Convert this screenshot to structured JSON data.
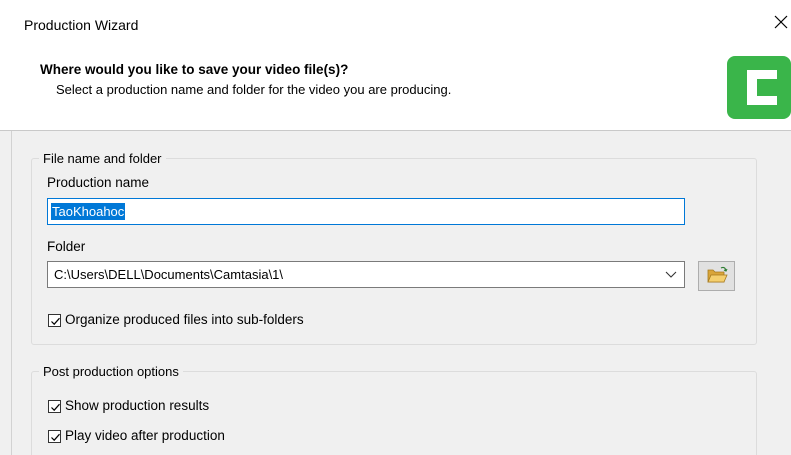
{
  "window": {
    "title": "Production Wizard"
  },
  "header": {
    "title": "Where would you like to save your video file(s)?",
    "subtitle": "Select a production name and folder for the video you are producing.",
    "logo_color": "#3ab54a"
  },
  "file_group": {
    "legend": "File name and folder",
    "production_name_label": "Production name",
    "production_name_value": "TaoKhoahoc",
    "folder_label": "Folder",
    "folder_value": "C:\\Users\\DELL\\Documents\\Camtasia\\1\\",
    "organize_label": "Organize produced files into sub-folders",
    "organize_checked": true
  },
  "post_group": {
    "legend": "Post production options",
    "show_results_label": "Show production results",
    "show_results_checked": true,
    "play_video_label": "Play video after production",
    "play_video_checked": true
  },
  "icons": {
    "close": "close-icon",
    "dropdown": "chevron-down-icon",
    "browse": "folder-open-icon",
    "logo": "camtasia-logo-icon"
  },
  "colors": {
    "accent": "#0078d7",
    "folder_icon": "#e8b94a"
  }
}
